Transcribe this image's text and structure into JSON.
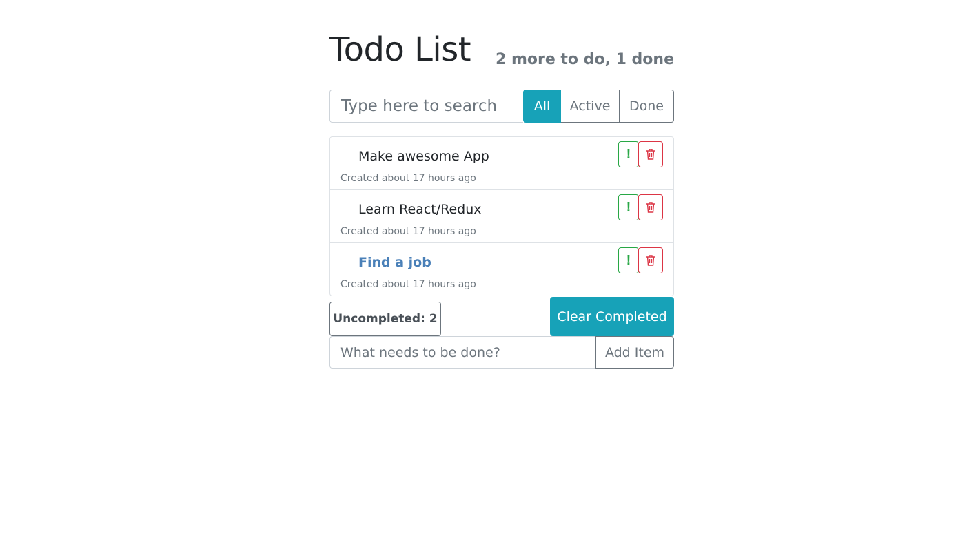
{
  "header": {
    "title": "Todo List",
    "summary": "2 more to do, 1 done"
  },
  "search": {
    "placeholder": "Type here to search",
    "value": ""
  },
  "filters": {
    "all": "All",
    "active": "Active",
    "done": "Done",
    "selected": "All"
  },
  "items": [
    {
      "label": "Make awesome App",
      "meta": "Created about 17 hours ago",
      "done": true,
      "important": false,
      "important_icon": "!",
      "delete_icon": "trash-icon"
    },
    {
      "label": "Learn React/Redux",
      "meta": "Created about 17 hours ago",
      "done": false,
      "important": false,
      "important_icon": "!",
      "delete_icon": "trash-icon"
    },
    {
      "label": "Find a job",
      "meta": "Created about 17 hours ago",
      "done": false,
      "important": true,
      "important_icon": "!",
      "delete_icon": "trash-icon"
    }
  ],
  "footer": {
    "uncompleted": "Uncompleted: 2",
    "clear_label": "Clear Completed"
  },
  "add": {
    "placeholder": "What needs to be done?",
    "value": "",
    "button_label": "Add Item"
  },
  "colors": {
    "accent": "#17a2b8",
    "important": "#28a745",
    "danger": "#dc3545",
    "important_text": "#4a80b8",
    "muted": "#6c757d"
  }
}
